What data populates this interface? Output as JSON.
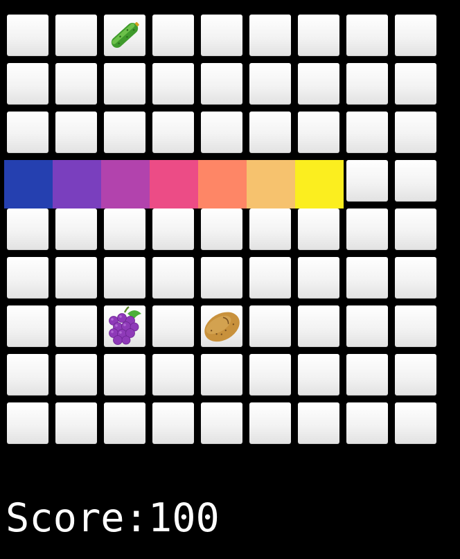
{
  "score": {
    "label": "Score:",
    "value": "100"
  },
  "board": {
    "rows": 9,
    "cols": 9,
    "tile_color": "#f4f4f4",
    "background": "#000000"
  },
  "items": [
    {
      "name": "cucumber-icon",
      "row": 0,
      "col": 2
    },
    {
      "name": "grapes-icon",
      "row": 6,
      "col": 2
    },
    {
      "name": "potato-icon",
      "row": 6,
      "col": 4
    }
  ],
  "snake": {
    "row": 3,
    "start_col": 0,
    "colors": [
      "#2540b0",
      "#7a3fbe",
      "#b243ad",
      "#ec4c86",
      "#fe8666",
      "#f6c26e",
      "#fbee1f"
    ]
  }
}
